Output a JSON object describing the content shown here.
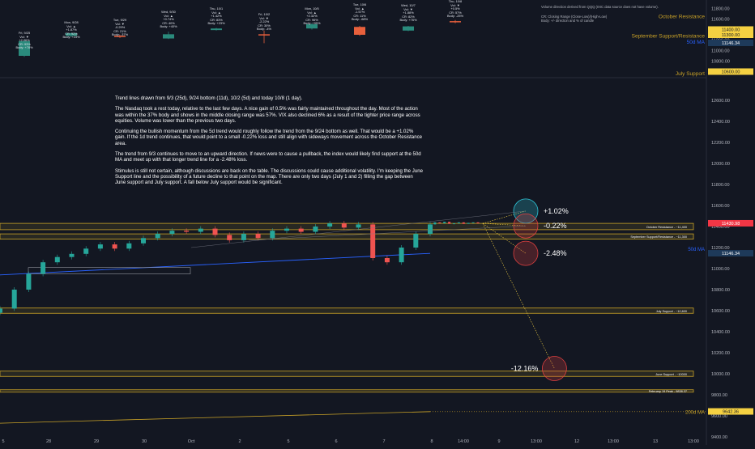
{
  "chart_data": {
    "type": "candlestick",
    "main_panel": {
      "ylim": [
        9400,
        12800
      ],
      "y_ticks": [
        9400,
        9600,
        9800,
        10000,
        10200,
        10400,
        10600,
        10800,
        11000,
        11200,
        11400,
        11600,
        11800,
        12000,
        12200,
        12400,
        12600
      ],
      "price_series": {
        "x": [
          0,
          1.5,
          3,
          4.5,
          6,
          7.5,
          9,
          10.5,
          12,
          13.5,
          15,
          16.5,
          18,
          19.5,
          21,
          22.5,
          24,
          25.5,
          27,
          28.5,
          30,
          31.5,
          33,
          34.5,
          36,
          37.5,
          39,
          40.5,
          42,
          43.5,
          45
        ],
        "close": [
          10620,
          10800,
          10950,
          11060,
          11110,
          11140,
          11190,
          11230,
          11190,
          11240,
          11290,
          11330,
          11360,
          11350,
          11380,
          11320,
          11270,
          11330,
          11290,
          11360,
          11380,
          11350,
          11400,
          11430,
          11390,
          11420,
          11100,
          11060,
          11200,
          11330,
          11420
        ]
      },
      "ongoing_candles": {
        "x": [
          45.5,
          46,
          46.5,
          47,
          47.5,
          48,
          48.5,
          49,
          49.5,
          50
        ],
        "close": [
          11440,
          11430,
          11445,
          11425,
          11430,
          11440,
          11425,
          11435,
          11440,
          11430
        ]
      },
      "ma50": {
        "x": [
          0,
          45
        ],
        "y": [
          10940,
          11145
        ]
      },
      "ma200": {
        "x": [
          0,
          45
        ],
        "y": [
          9530,
          9640
        ]
      },
      "zones": [
        {
          "label": "October Resistance - ~11,400",
          "y": [
            11370,
            11430
          ],
          "color": "#c9a227"
        },
        {
          "label": "September Support/Resistance - ~11,300",
          "y": [
            11280,
            11330
          ],
          "color": "#c9a227"
        },
        {
          "label": "July Support - ~10,600",
          "y": [
            10575,
            10625
          ],
          "color": "#c9a227"
        },
        {
          "label": "June Support - ~10000",
          "y": [
            9975,
            10025
          ],
          "color": "#c9a227"
        },
        {
          "label": "February 19 Peak - 9838.37",
          "y": [
            9828,
            9848
          ],
          "color": "#c9a227"
        }
      ],
      "projections": [
        {
          "label": "+1.02%",
          "target": 11547,
          "x": 55
        },
        {
          "label": "-0.22%",
          "target": 11406,
          "x": 55
        },
        {
          "label": "-2.48%",
          "target": 11145,
          "x": 55
        },
        {
          "label": "-12.16%",
          "target": 10050,
          "x": 58
        }
      ],
      "price_labels": [
        {
          "text": "11430.98",
          "y": 11431,
          "bg": "#f23645"
        },
        {
          "text": "50d MA",
          "y": 11185,
          "bg": ""
        },
        {
          "text": "11146.34",
          "y": 11146,
          "bg": "#1e3a5a"
        },
        {
          "text": "200d MA",
          "y": 9635,
          "bg": ""
        },
        {
          "text": "9642.36",
          "y": 9642,
          "bg": "#f5d142"
        }
      ]
    },
    "top_panel": {
      "ylim": [
        10500,
        11900
      ],
      "y_ticks": [
        10600,
        10800,
        11000,
        11200,
        11400,
        11600,
        11800
      ],
      "level_labels": [
        {
          "text": "October Resistance",
          "y": 11650
        },
        {
          "text": "September Support/Resistance",
          "y": 11280
        },
        {
          "text": "50d MA",
          "y": 11160
        },
        {
          "text": "July Support",
          "y": 10560
        }
      ],
      "price_labels": [
        {
          "text": "11400.00",
          "y": 11400,
          "bg": "#f5d142"
        },
        {
          "text": "11300.00",
          "y": 11300,
          "bg": "#f5d142"
        },
        {
          "text": "11146.34",
          "y": 11146,
          "bg": "#1e3a5a"
        },
        {
          "text": "10600.00",
          "y": 10600,
          "bg": "#f5d142"
        }
      ],
      "candles": [
        {
          "x": 30,
          "open": 11180,
          "close": 10900,
          "high": 11200,
          "low": 10880,
          "color": "#2a8a7c"
        },
        {
          "x": 88,
          "open": 11330,
          "close": 11280,
          "high": 11340,
          "low": 11260,
          "color": "#2a8a7c"
        },
        {
          "x": 148,
          "open": 11280,
          "close": 11260,
          "high": 11300,
          "low": 11240,
          "color": "#e8603c"
        },
        {
          "x": 208,
          "open": 11310,
          "close": 11230,
          "high": 11360,
          "low": 11220,
          "color": "#2a8a7c"
        },
        {
          "x": 267,
          "open": 11390,
          "close": 11420,
          "high": 11430,
          "low": 11380,
          "color": "#2a8a7c"
        },
        {
          "x": 326,
          "open": 11310,
          "close": 11290,
          "high": 11380,
          "low": 11140,
          "color": "#e8603c"
        },
        {
          "x": 385,
          "open": 11420,
          "close": 11500,
          "high": 11520,
          "low": 11400,
          "color": "#2a8a7c"
        },
        {
          "x": 444,
          "open": 11450,
          "close": 11300,
          "high": 11470,
          "low": 11280,
          "color": "#e8603c"
        },
        {
          "x": 504,
          "open": 11380,
          "close": 11460,
          "high": 11470,
          "low": 11370,
          "color": "#2a8a7c"
        },
        {
          "x": 562,
          "open": 11560,
          "close": 11540,
          "high": 11580,
          "low": 11520,
          "color": "#e8603c"
        }
      ]
    },
    "x_ticks": [
      "5",
      "28",
      "29",
      "30",
      "Oct",
      "2",
      "5",
      "6",
      "7",
      "8",
      "14:00",
      "9",
      "13:00",
      "12",
      "13:00",
      "13",
      "13:00"
    ],
    "legend": {
      "lines": [
        "Volume direction derived from QQQ (IXIC data source does not have volume).",
        "CR: Closing Range (Close-Low)/(High-Low)",
        "Body: +/- direction and % of candle"
      ]
    }
  },
  "stat_cards": [
    {
      "lines": [
        "Fri, 9/25",
        "Vol: ▼",
        "+2.26%",
        "CR: 93%",
        "Body: +78%"
      ]
    },
    {
      "lines": [
        "Mon, 9/28",
        "Vol: ▲",
        "+1.87%",
        "CR: 92%",
        "Body: +23%"
      ]
    },
    {
      "lines": [
        "Tue, 9/29",
        "Vol: ▼",
        "-0.29%",
        "CR: 21%",
        "Body: -37%"
      ]
    },
    {
      "lines": [
        "Wed, 9/30",
        "Vol: ▲",
        "+0.74%",
        "CR: 40%",
        "Body: +40%"
      ]
    },
    {
      "lines": [
        "Thu, 10/1",
        "Vol: ▲",
        "+1.42%",
        "CR: 83%",
        "Body: +23%"
      ]
    },
    {
      "lines": [
        "Fri, 10/2",
        "Vol: ▼",
        "-2.22%",
        "CR: 30%",
        "Body: -4%"
      ]
    },
    {
      "lines": [
        "Mon, 10/5",
        "Vol: ▲",
        "+2.32%",
        "CR: 96%",
        "Body: +95%"
      ]
    },
    {
      "lines": [
        "Tue, 10/6",
        "Vol: ▲",
        "-1.57%",
        "CR: 11%",
        "Body: -68%"
      ]
    },
    {
      "lines": [
        "Wed, 10/7",
        "Vol: ▼",
        "+1.88%",
        "CR: 82%",
        "Body: +76%"
      ]
    },
    {
      "lines": [
        "Thu, 10/8",
        "Vol: ▼",
        "+0.5%",
        "CR: 57%",
        "Body: -25%"
      ]
    }
  ],
  "commentary": {
    "p1": "Trend lines drawn from 9/3 (25d), 9/24 bottom (11d), 10/2 (5d) and today 10/8 (1 day).",
    "p2": "The Nasdaq took a rest today, relative to the last few days. A nice gain of 0.5% was fairly maintained throughout the day. Most of the action was within the 37% body and shows in the middle closing range was 57%.  VIX also declined 6% as a result of the tighter price range across equities. Volume was lower than the previous two days.",
    "p3": "Continuing the bullish momentum from the 5d trend would roughly follow the trend from the 9/24 bottom as well. That would be a +1.02% gain. If the 1d trend continues, that would point to a small -0.22% loss and still align with sideways movement across the October Resistance area.",
    "p4": "The trend from 9/3 continues to move to an upward direction. If news were to cause a pullback, the index would likely find support at the 50d MA and meet up with that longer trend line for a -2.48% loss.",
    "p5": "Stimulus is still not certain, although discussions are back on the table. The discussions could cause additional volatility. I'm keeping the June Support line and the possibility of a future decline to that point on the map.  There are only two days (July 1 and 2) filling the gap between June support and July support. A fall below July support would be significant."
  },
  "colors": {
    "background": "#131722",
    "zone": "#c9a227",
    "up": "#26a69a",
    "down": "#ef5350",
    "ma50": "#2962ff",
    "projection_up": "#2ec4d6",
    "projection_down": "#e04040"
  }
}
